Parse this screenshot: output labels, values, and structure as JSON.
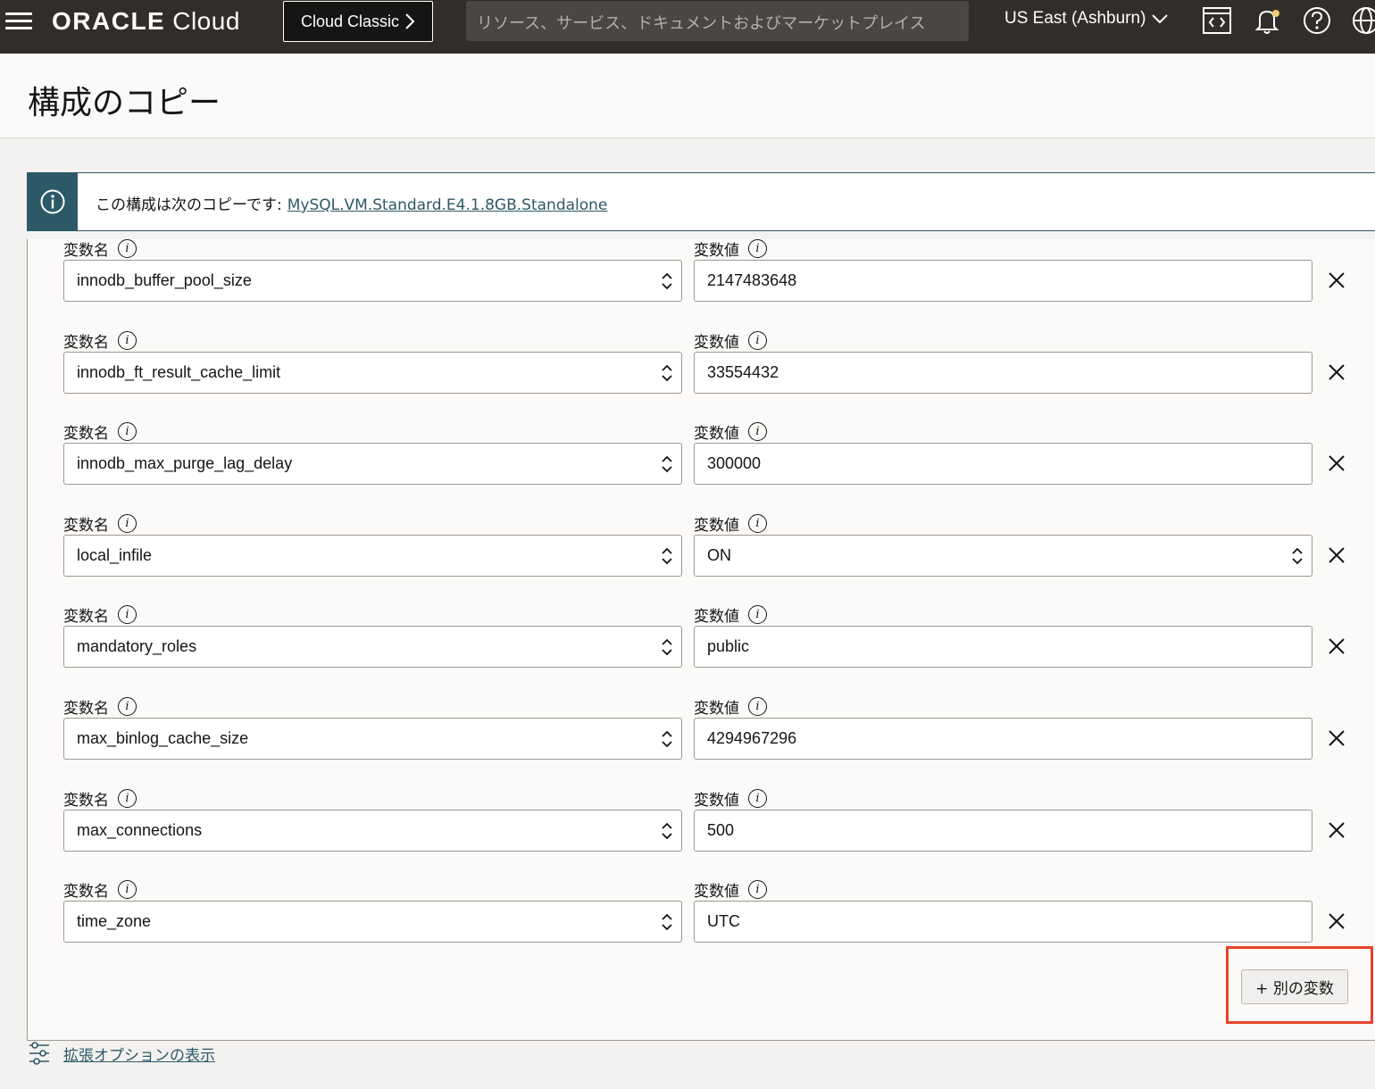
{
  "header": {
    "menu_icon": "hamburger-menu-icon",
    "brand_oracle": "ORACLE",
    "brand_cloud": "Cloud",
    "classic_button": "Cloud Classic",
    "search_placeholder": "リソース、サービス、ドキュメントおよびマーケットプレイス",
    "region": "US East (Ashburn)",
    "icons": [
      "code-editor-icon",
      "bell-icon",
      "help-icon",
      "globe-icon"
    ]
  },
  "page": {
    "title": "構成のコピー"
  },
  "banner": {
    "text": "この構成は次のコピーです:",
    "link": "MySQL.VM.Standard.E4.1.8GB.Standalone"
  },
  "labels": {
    "name": "変数名",
    "value": "変数値"
  },
  "variables": [
    {
      "name": "innodb_buffer_pool_size",
      "value": "2147483648",
      "value_select": false
    },
    {
      "name": "innodb_ft_result_cache_limit",
      "value": "33554432",
      "value_select": false
    },
    {
      "name": "innodb_max_purge_lag_delay",
      "value": "300000",
      "value_select": false
    },
    {
      "name": "local_infile",
      "value": "ON",
      "value_select": true
    },
    {
      "name": "mandatory_roles",
      "value": "public",
      "value_select": false
    },
    {
      "name": "max_binlog_cache_size",
      "value": "4294967296",
      "value_select": false
    },
    {
      "name": "max_connections",
      "value": "500",
      "value_select": false
    },
    {
      "name": "time_zone",
      "value": "UTC",
      "value_select": false
    }
  ],
  "add_button": "+ 別の変数",
  "advanced_link": "拡張オプションの表示",
  "colors": {
    "header_bg": "#312d2a",
    "link": "#2c5967",
    "highlight": "#e8412a"
  }
}
